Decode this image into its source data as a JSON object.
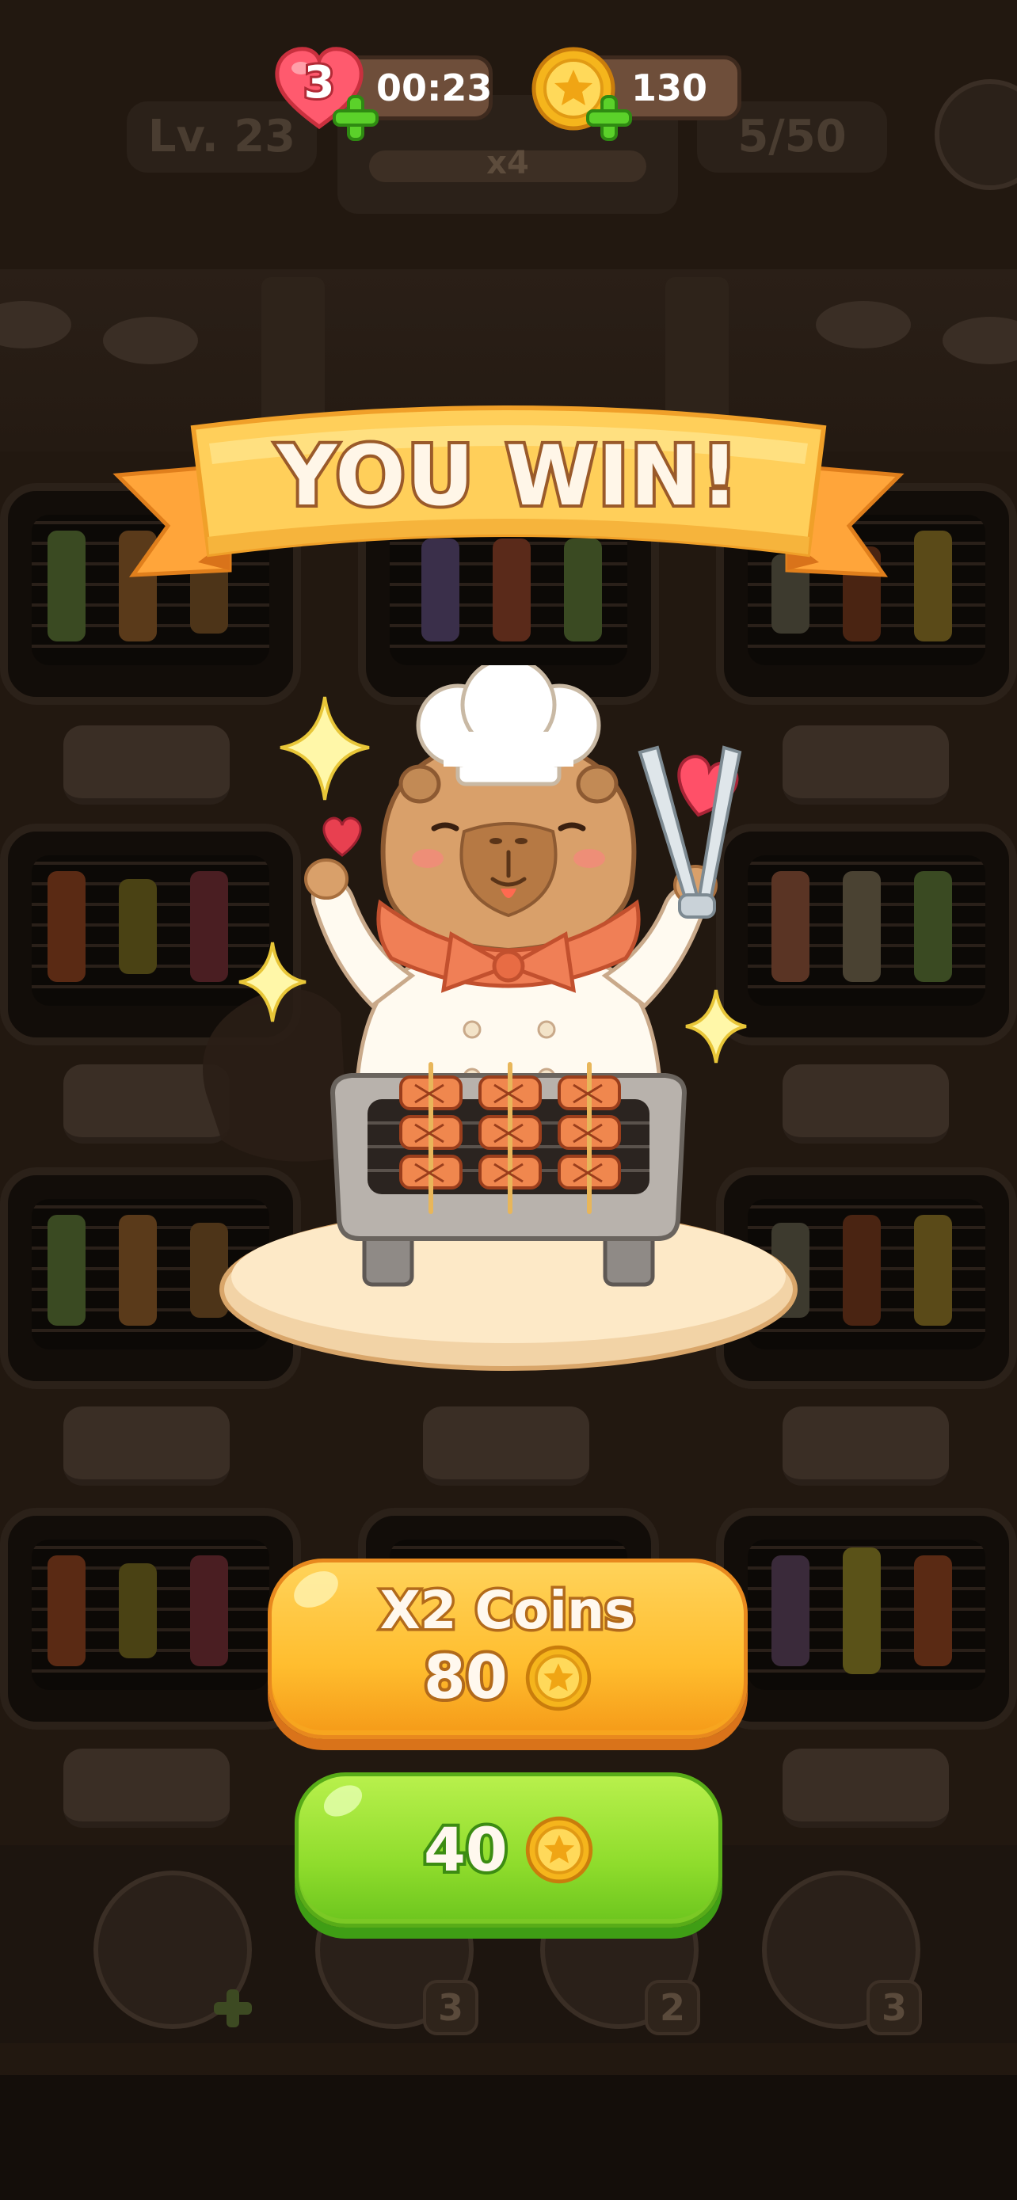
{
  "hud": {
    "lives": "3",
    "timer": "00:23",
    "coins": "130"
  },
  "board": {
    "level": "Lv. 23",
    "multiplier": "x4",
    "progress": "5/50",
    "tools": [
      {
        "name": "bag",
        "count": ""
      },
      {
        "name": "undo",
        "count": "3"
      },
      {
        "name": "shuffle",
        "count": "2"
      },
      {
        "name": "hammer",
        "count": "3"
      }
    ]
  },
  "banner": {
    "title": "YOU WIN!"
  },
  "buttons": {
    "double_label": "X2 Coins",
    "double_amount": "80",
    "claim_amount": "40"
  },
  "colors": {
    "ribbon": "#ffcf5a",
    "double_button": "#ffbd2e",
    "claim_button": "#8fdc2c",
    "coin": "#f5b51c"
  }
}
